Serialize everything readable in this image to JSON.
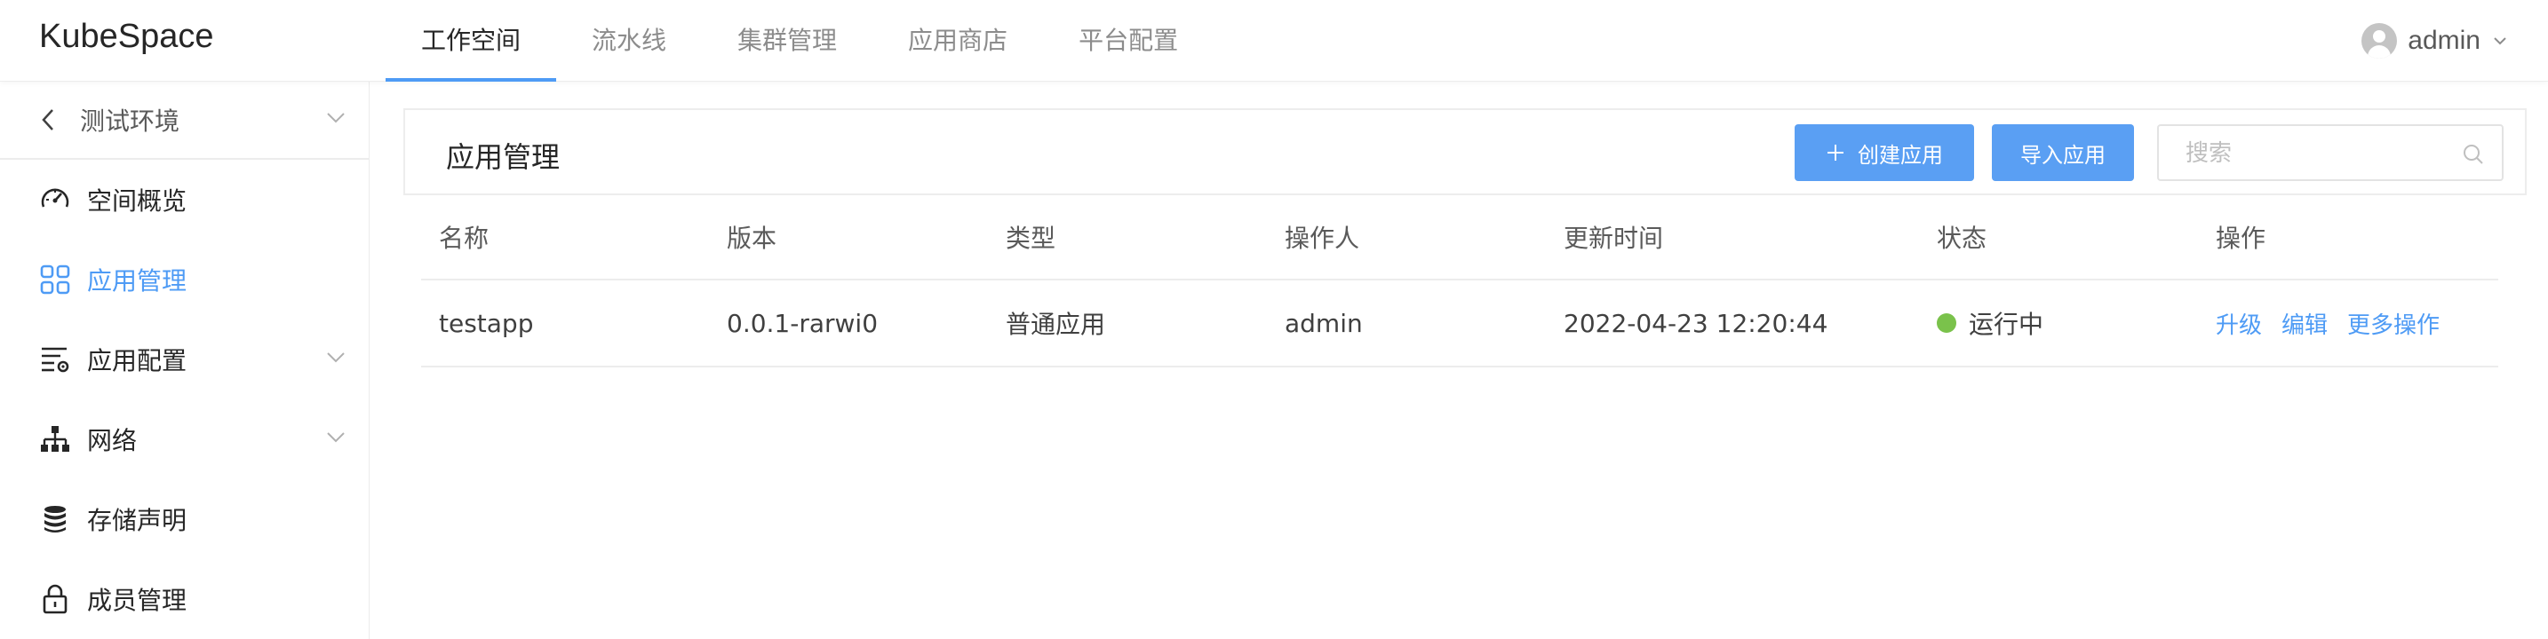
{
  "app": {
    "logo": "KubeSpace"
  },
  "nav": {
    "tabs": [
      {
        "label": "工作空间",
        "active": true
      },
      {
        "label": "流水线",
        "active": false
      },
      {
        "label": "集群管理",
        "active": false
      },
      {
        "label": "应用商店",
        "active": false
      },
      {
        "label": "平台配置",
        "active": false
      }
    ]
  },
  "user": {
    "name": "admin"
  },
  "sidebar": {
    "environment": "测试环境",
    "items": [
      {
        "label": "空间概览",
        "icon": "dashboard-icon",
        "active": false,
        "expandable": false
      },
      {
        "label": "应用管理",
        "icon": "appstore-icon",
        "active": true,
        "expandable": false
      },
      {
        "label": "应用配置",
        "icon": "config-list-icon",
        "active": false,
        "expandable": true
      },
      {
        "label": "网络",
        "icon": "network-icon",
        "active": false,
        "expandable": true
      },
      {
        "label": "存储声明",
        "icon": "database-icon",
        "active": false,
        "expandable": false
      },
      {
        "label": "成员管理",
        "icon": "lock-icon",
        "active": false,
        "expandable": false
      }
    ]
  },
  "main": {
    "title": "应用管理",
    "create_button": "创建应用",
    "import_button": "导入应用",
    "search": {
      "placeholder": "搜索",
      "value": ""
    }
  },
  "table": {
    "columns": [
      "名称",
      "版本",
      "类型",
      "操作人",
      "更新时间",
      "状态",
      "操作"
    ],
    "rows": [
      {
        "name": "testapp",
        "version": "0.0.1-rarwi0",
        "type": "普通应用",
        "operator": "admin",
        "updated": "2022-04-23 12:20:44",
        "status": "运行中",
        "actions": [
          "升级",
          "编辑",
          "更多操作"
        ]
      }
    ]
  },
  "colors": {
    "accent": "#4e9bf5",
    "button": "#5a9ff3",
    "status_running": "#7ac24b"
  }
}
